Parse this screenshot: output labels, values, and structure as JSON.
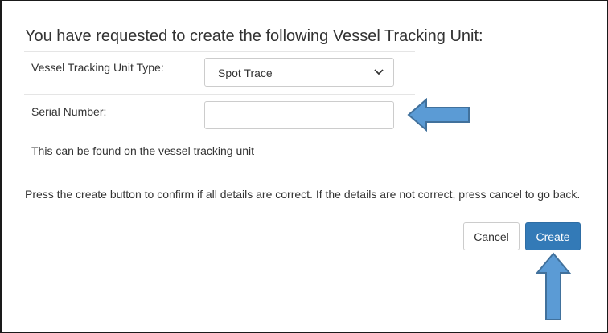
{
  "dialog": {
    "heading": "You have requested to create the following Vessel Tracking Unit:",
    "type_label": "Vessel Tracking Unit Type:",
    "type_selected": "Spot Trace",
    "serial_label": "Serial Number:",
    "serial_value": "",
    "serial_help": "This can be found on the vessel tracking unit",
    "confirm_message": "Press the create button to confirm if all details are correct. If the details are not correct, press cancel to go back.",
    "cancel_label": "Cancel",
    "create_label": "Create"
  },
  "annotations": {
    "arrow_color": "#5b9bd5",
    "arrow_outline": "#41719c",
    "arrow_left_icon": "arrow-left-icon",
    "arrow_up_icon": "arrow-up-icon"
  },
  "colors": {
    "primary": "#337ab7",
    "border": "#cccccc",
    "text": "#333333"
  }
}
